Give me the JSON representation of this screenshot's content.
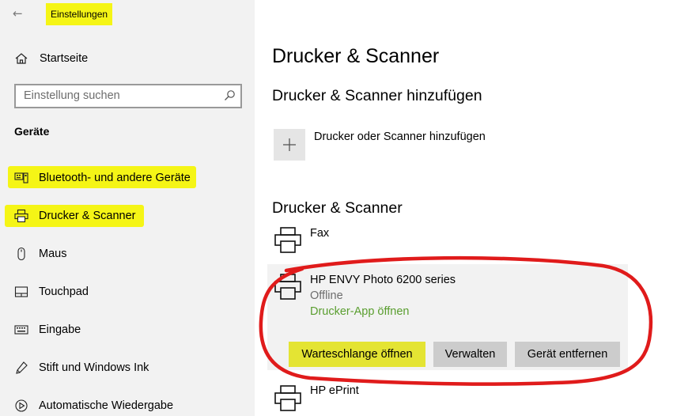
{
  "window": {
    "title": "Einstellungen",
    "back_icon": "back-arrow-icon"
  },
  "sidebar": {
    "home_label": "Startseite",
    "search_placeholder": "Einstellung suchen",
    "section": "Geräte",
    "items": [
      {
        "label": "Bluetooth- und andere Geräte",
        "icon": "bluetooth-devices-icon"
      },
      {
        "label": "Drucker & Scanner",
        "icon": "printer-icon"
      },
      {
        "label": "Maus",
        "icon": "mouse-icon"
      },
      {
        "label": "Touchpad",
        "icon": "touchpad-icon"
      },
      {
        "label": "Eingabe",
        "icon": "keyboard-icon"
      },
      {
        "label": "Stift und Windows Ink",
        "icon": "pen-icon"
      },
      {
        "label": "Automatische Wiedergabe",
        "icon": "autoplay-icon"
      }
    ]
  },
  "main": {
    "title": "Drucker & Scanner",
    "add_section_title": "Drucker & Scanner hinzufügen",
    "add_label": "Drucker oder Scanner hinzufügen",
    "list_title": "Drucker & Scanner",
    "printers": [
      {
        "name": "Fax"
      },
      {
        "name": "HP ENVY Photo 6200 series",
        "status": "Offline",
        "link": "Drucker-App öffnen"
      },
      {
        "name": "HP ePrint"
      }
    ],
    "buttons": {
      "queue": "Warteschlange öffnen",
      "manage": "Verwalten",
      "remove": "Gerät entfernen"
    }
  },
  "colors": {
    "highlight": "#f5f516",
    "annotation_red": "#e01b1b",
    "link_green": "#5a9e2f",
    "sidebar_bg": "#f2f2f2"
  }
}
